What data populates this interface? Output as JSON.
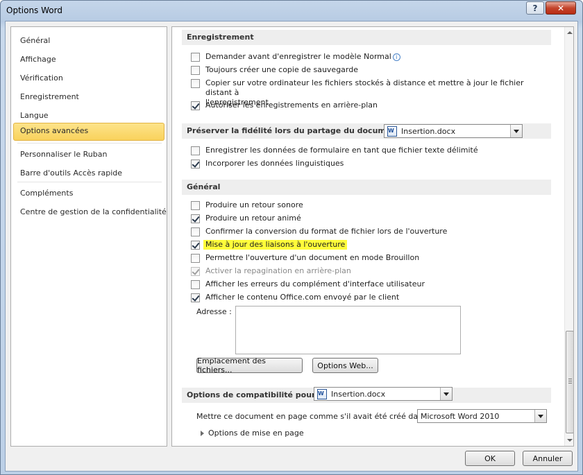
{
  "window": {
    "title": "Options Word",
    "help_label": "?",
    "close_label": "✕"
  },
  "sidebar": {
    "items": [
      {
        "label": "Général"
      },
      {
        "label": "Affichage"
      },
      {
        "label": "Vérification"
      },
      {
        "label": "Enregistrement"
      },
      {
        "label": "Langue"
      },
      {
        "label": "Options avancées",
        "selected": true
      },
      {
        "label": "Personnaliser le Ruban"
      },
      {
        "label": "Barre d'outils Accès rapide"
      },
      {
        "label": "Compléments"
      },
      {
        "label": "Centre de gestion de la confidentialité"
      }
    ]
  },
  "content": {
    "sections": {
      "save": "Enregistrement",
      "fidelity": "Préserver la fidélité lors du partage du document :",
      "general": "Général",
      "compat": "Options de compatibilité pour :"
    },
    "save_options": [
      {
        "label": "Demander avant d'enregistrer le modèle Normal",
        "checked": false,
        "info_icon": "info-icon"
      },
      {
        "label": "Toujours créer une copie de sauvegarde",
        "checked": false
      },
      {
        "label": "Copier sur votre ordinateur les fichiers stockés à distance et mettre à jour le fichier distant à",
        "label_line2": "l'enregistrement",
        "checked": false
      },
      {
        "label": "Autoriser les enregistrements en arrière-plan",
        "checked": true
      }
    ],
    "fidelity_document": "Insertion.docx",
    "fidelity_options": [
      {
        "label": "Enregistrer les données de formulaire en tant que fichier texte délimité",
        "checked": false
      },
      {
        "label": "Incorporer les données linguistiques",
        "checked": true
      }
    ],
    "general_options": [
      {
        "label": "Produire un retour sonore",
        "checked": false
      },
      {
        "label": "Produire un retour animé",
        "checked": true
      },
      {
        "label": "Confirmer la conversion du format de fichier lors de l'ouverture",
        "checked": false
      },
      {
        "label": "Mise à jour des liaisons à l'ouverture",
        "checked": true,
        "highlighted": true
      },
      {
        "label": "Permettre l'ouverture d'un document en mode Brouillon",
        "checked": false
      },
      {
        "label": "Activer la repagination en arrière-plan",
        "checked": true,
        "disabled": true
      },
      {
        "label": "Afficher les erreurs du complément d'interface utilisateur",
        "checked": false
      },
      {
        "label": "Afficher le contenu Office.com envoyé par le client",
        "checked": true
      }
    ],
    "address_label": "Adresse :",
    "address_value": "",
    "file_locations_button": "Emplacement des fichiers...",
    "web_options_button": "Options Web...",
    "compat_document": "Insertion.docx",
    "layout_as_label": "Mettre ce document en page comme s'il avait été créé dans :",
    "layout_as_value": "Microsoft Word 2010",
    "layout_options_label": "Options de mise en page"
  },
  "footer": {
    "ok_label": "OK",
    "cancel_label": "Annuler"
  },
  "colors": {
    "selected_nav": "#f9d25c",
    "highlight": "#fffc3a",
    "section_header": "#eeeeee"
  }
}
